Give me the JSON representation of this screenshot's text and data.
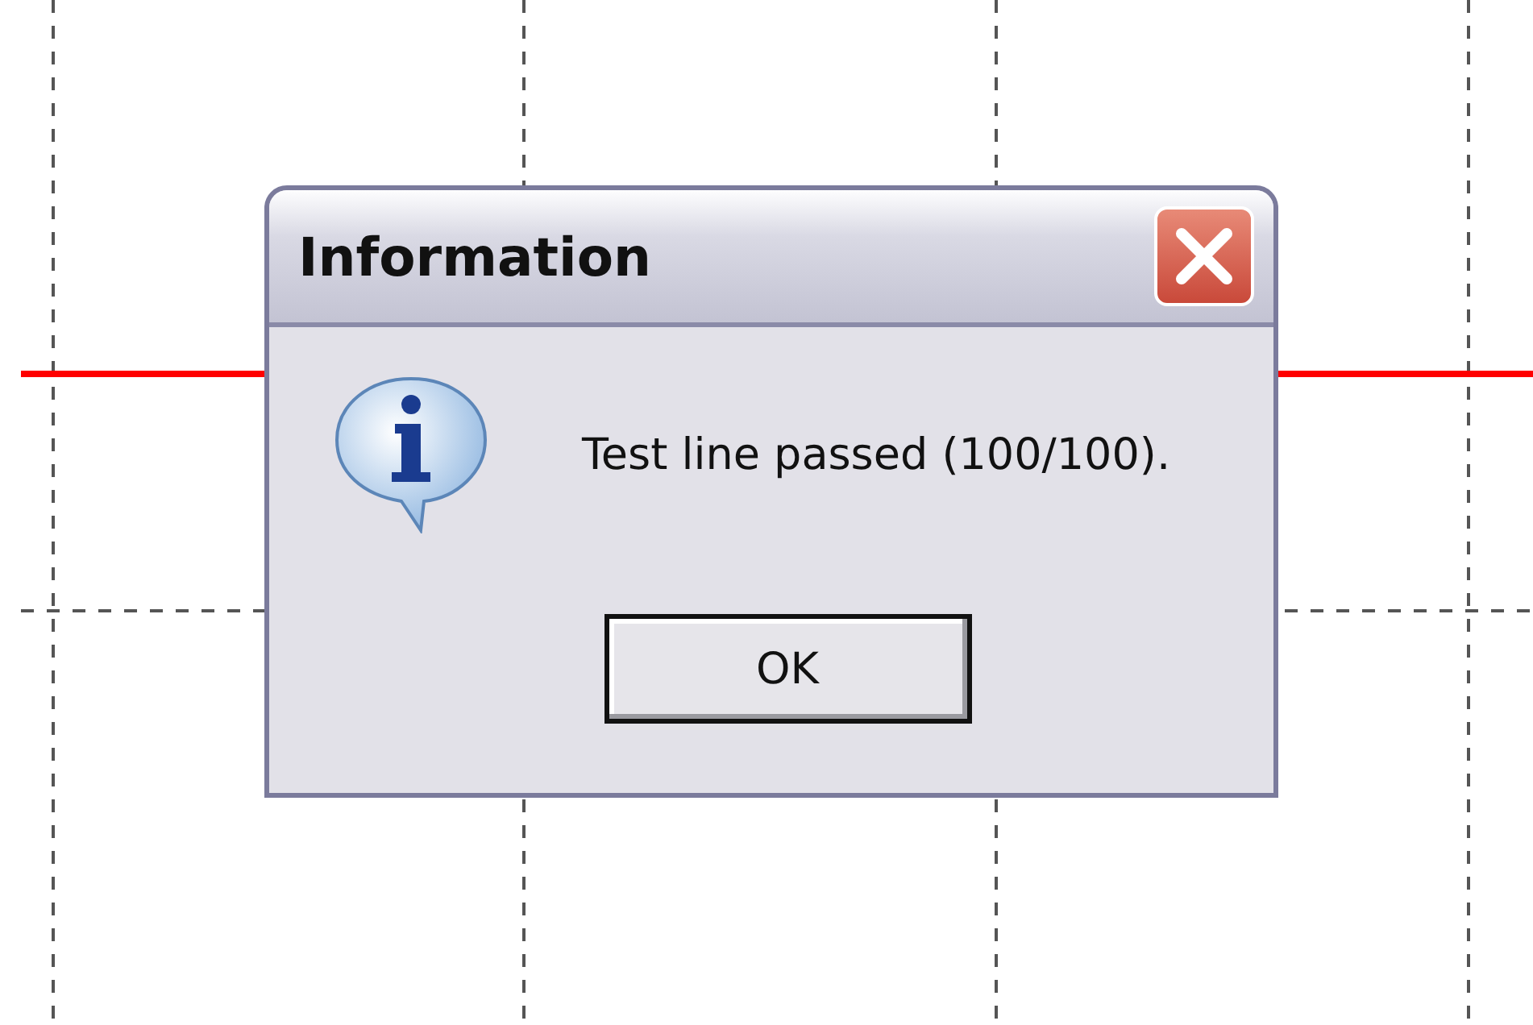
{
  "dialog": {
    "title": "Information",
    "message": "Test line passed (100/100).",
    "buttons": [
      "OK"
    ]
  }
}
